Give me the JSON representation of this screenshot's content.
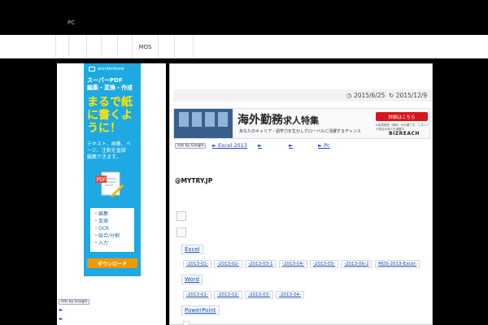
{
  "header": {
    "text": "PC"
  },
  "nav": {
    "items": [
      "",
      "",
      "",
      "",
      "MOS",
      "",
      "",
      ""
    ]
  },
  "sidebar": {
    "ad": {
      "brand": "wondershare",
      "headline": "スーパーPDF\n編集・変換・作成",
      "big": "まるで紙\nに書くよ\nうに！",
      "body": "テキスト、画像、ペ\nージ、注釈を直接\n編集できます。",
      "pdf_label": "PDF",
      "list": [
        "・編集",
        "・変換",
        "・OCR",
        "・結合/分割",
        "・入力"
      ],
      "download": "ダウンロード"
    },
    "adchoice": "Ads by Google",
    "links": [
      "►",
      "►"
    ]
  },
  "meta": {
    "published": "2015/6/25",
    "updated": "2015/12/9"
  },
  "banner": {
    "title_a": "海外勤務",
    "title_b": "求人特集",
    "sub": "あなたのキャリア・語学力を生かしグローバルに活躍するチャンス",
    "button": "詳細はこちら",
    "note": "※会員登録（無料）が必要です。ビズリーチ経由の求人を掲載中",
    "logo": "BIZREACH"
  },
  "adlinks": {
    "choice": "Ads by Google",
    "links": [
      "► Excel 2013",
      "►",
      "►",
      "► Pc"
    ]
  },
  "author": "@MYTRY.JP",
  "categories": [
    {
      "name": "Excel",
      "items": [
        "-2013-01-",
        "-2013-02-",
        "-2013-03-1",
        "-2013-04-",
        "-2013-05-",
        "-2013-06-2",
        "MOS-2013-Excel-"
      ]
    },
    {
      "name": "Word",
      "items": [
        "-2013-01-",
        "-2013-02-",
        "-2013-03-",
        "-2013-04-"
      ]
    },
    {
      "name": "PowerPoint",
      "items": []
    }
  ],
  "colors": {
    "background": "#000000",
    "link": "#1a4fb0",
    "ad_blue": "#1ea9e3",
    "banner_red": "#d6161b"
  }
}
